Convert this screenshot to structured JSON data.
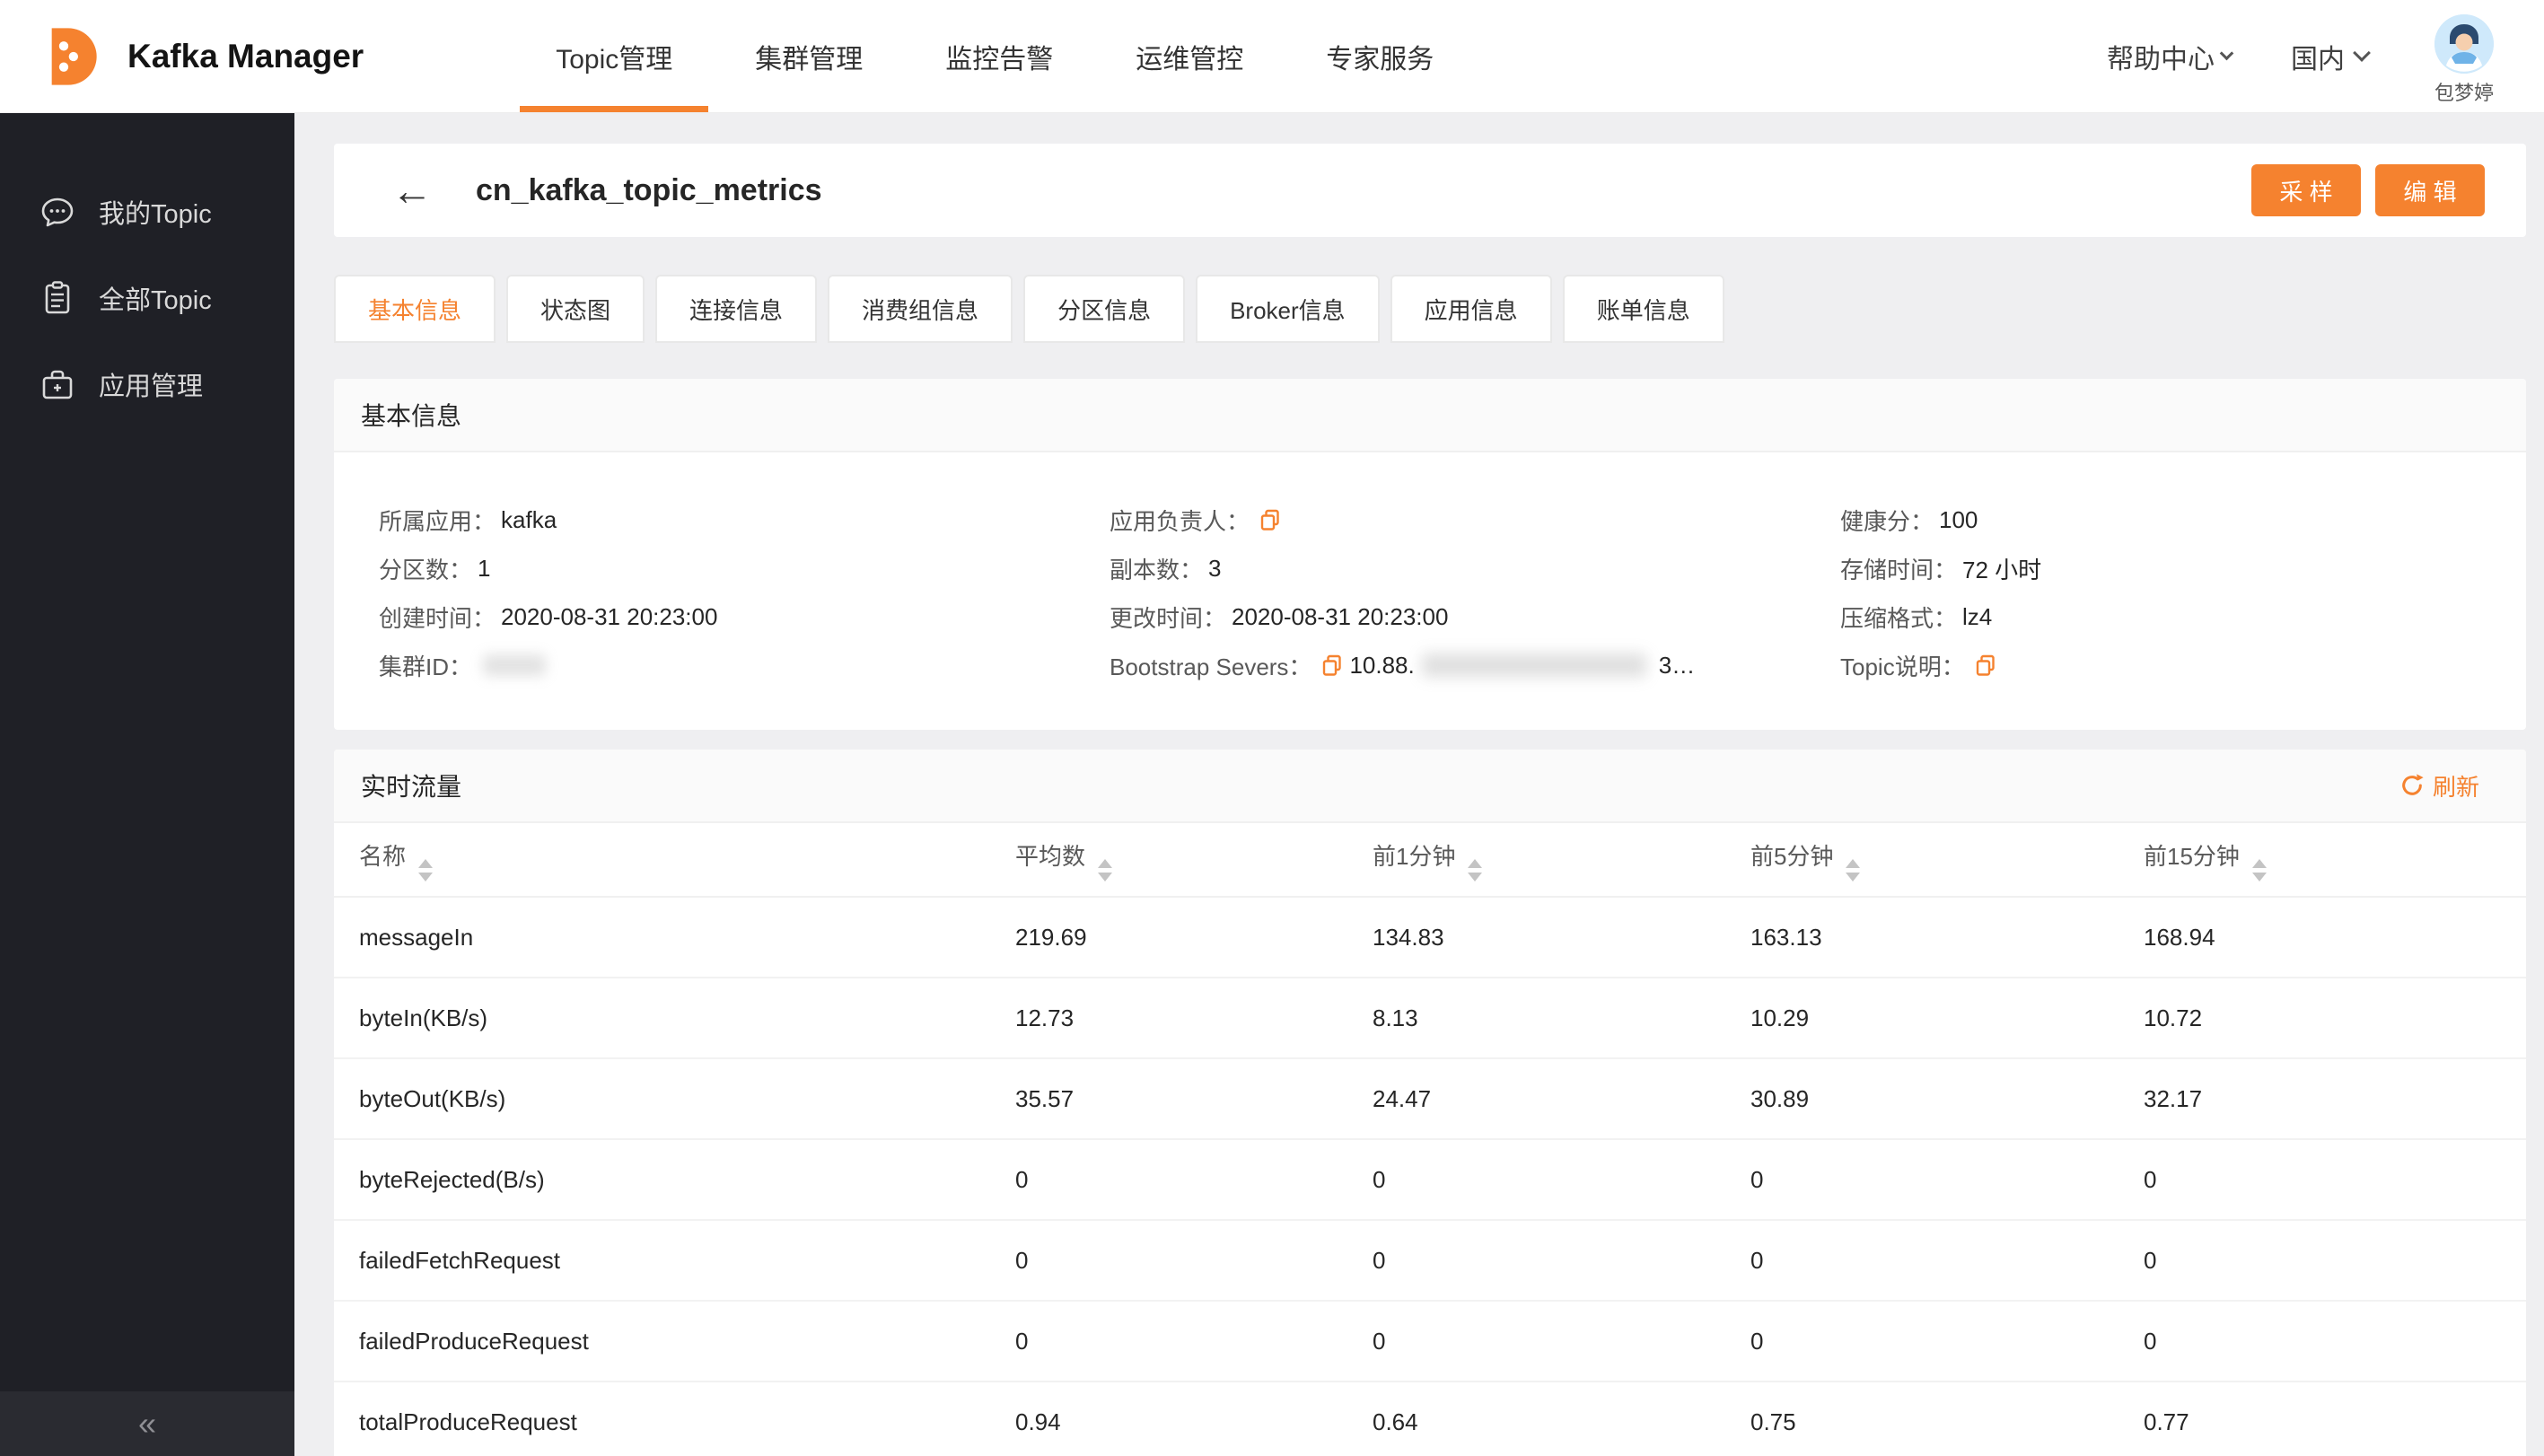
{
  "colors": {
    "accent": "#F5822F",
    "sidebar_bg": "#1F2026"
  },
  "header": {
    "app_title": "Kafka Manager",
    "nav": [
      {
        "label": "Topic管理",
        "active": true
      },
      {
        "label": "集群管理",
        "active": false
      },
      {
        "label": "监控告警",
        "active": false
      },
      {
        "label": "运维管控",
        "active": false
      },
      {
        "label": "专家服务",
        "active": false
      }
    ],
    "help_center": "帮助中心",
    "region": "国内",
    "user_name": "包梦婷"
  },
  "sidebar": {
    "items": [
      {
        "label": "我的Topic",
        "icon": "chat-bubble-icon"
      },
      {
        "label": "全部Topic",
        "icon": "clipboard-icon"
      },
      {
        "label": "应用管理",
        "icon": "app-box-icon"
      }
    ],
    "collapse_icon": "«"
  },
  "page": {
    "back_icon": "←",
    "title": "cn_kafka_topic_metrics",
    "actions": {
      "sample": "采 样",
      "edit": "编 辑"
    },
    "tabs": [
      {
        "label": "基本信息",
        "active": true
      },
      {
        "label": "状态图",
        "active": false
      },
      {
        "label": "连接信息",
        "active": false
      },
      {
        "label": "消费组信息",
        "active": false
      },
      {
        "label": "分区信息",
        "active": false
      },
      {
        "label": "Broker信息",
        "active": false
      },
      {
        "label": "应用信息",
        "active": false
      },
      {
        "label": "账单信息",
        "active": false
      }
    ]
  },
  "basic_info": {
    "section_title": "基本信息",
    "fields": [
      {
        "label": "所属应用：",
        "value": "kafka"
      },
      {
        "label": "应用负责人：",
        "value": "",
        "copy": true
      },
      {
        "label": "健康分：",
        "value": "100"
      },
      {
        "label": "分区数：",
        "value": "1"
      },
      {
        "label": "副本数：",
        "value": "3"
      },
      {
        "label": "存储时间：",
        "value": "72 小时"
      },
      {
        "label": "创建时间：",
        "value": "2020-08-31 20:23:00"
      },
      {
        "label": "更改时间：",
        "value": "2020-08-31 20:23:00"
      },
      {
        "label": "压缩格式：",
        "value": "lz4"
      },
      {
        "label": "集群ID：",
        "value": "",
        "redacted": true
      },
      {
        "label": "Bootstrap Severs：",
        "value": "10.88.",
        "value_suffix": "3…",
        "copy": true,
        "redacted": true
      },
      {
        "label": "Topic说明：",
        "value": "",
        "copy": true
      }
    ]
  },
  "realtime_traffic": {
    "section_title": "实时流量",
    "refresh_label": "刷新",
    "table": {
      "columns": [
        "名称",
        "平均数",
        "前1分钟",
        "前5分钟",
        "前15分钟"
      ],
      "rows": [
        {
          "name": "messageIn",
          "values": [
            "219.69",
            "134.83",
            "163.13",
            "168.94"
          ]
        },
        {
          "name": "byteIn(KB/s)",
          "values": [
            "12.73",
            "8.13",
            "10.29",
            "10.72"
          ]
        },
        {
          "name": "byteOut(KB/s)",
          "values": [
            "35.57",
            "24.47",
            "30.89",
            "32.17"
          ]
        },
        {
          "name": "byteRejected(B/s)",
          "values": [
            "0",
            "0",
            "0",
            "0"
          ]
        },
        {
          "name": "failedFetchRequest",
          "values": [
            "0",
            "0",
            "0",
            "0"
          ]
        },
        {
          "name": "failedProduceRequest",
          "values": [
            "0",
            "0",
            "0",
            "0"
          ]
        },
        {
          "name": "totalProduceRequest",
          "values": [
            "0.94",
            "0.64",
            "0.75",
            "0.77"
          ]
        }
      ]
    }
  }
}
